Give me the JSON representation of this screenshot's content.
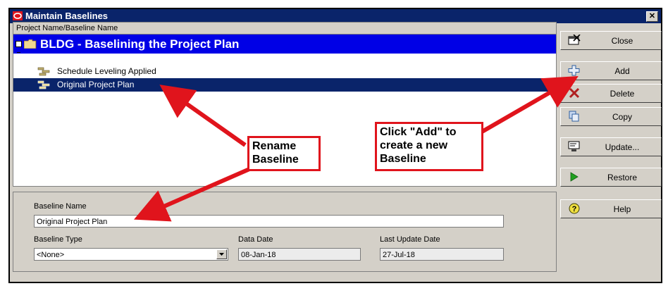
{
  "window": {
    "title": "Maintain Baselines",
    "close_glyph": "✕"
  },
  "tree": {
    "column_header": "Project Name/Baseline Name",
    "project": {
      "label": "BLDG - Baselining the Project Plan",
      "expanded": true
    },
    "baselines": [
      {
        "label": "Schedule Leveling Applied",
        "selected": false
      },
      {
        "label": "Original Project Plan",
        "selected": true
      }
    ]
  },
  "details": {
    "baseline_name_label": "Baseline Name",
    "baseline_name_value": "Original Project Plan",
    "baseline_type_label": "Baseline Type",
    "baseline_type_value": "<None>",
    "data_date_label": "Data Date",
    "data_date_value": "08-Jan-18",
    "last_update_label": "Last Update Date",
    "last_update_value": "27-Jul-18"
  },
  "buttons": {
    "close": "Close",
    "add": "Add",
    "delete": "Delete",
    "copy": "Copy",
    "update": "Update...",
    "restore": "Restore",
    "help": "Help"
  },
  "annotations": {
    "rename_line1": "Rename",
    "rename_line2": "Baseline",
    "add_line1": "Click \"Add\" to",
    "add_line2": "create a new",
    "add_line3": "Baseline"
  },
  "colors": {
    "title_bar": "#0a246a",
    "project_row": "#0000e6",
    "selected_row": "#0a246a",
    "annotation_red": "#e0141c"
  }
}
